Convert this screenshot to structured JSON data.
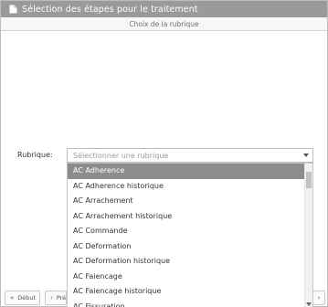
{
  "window": {
    "title": "Sélection des étapes pour le traitement",
    "icon": "document-icon"
  },
  "subheader": {
    "title": "Choix de la rubrique"
  },
  "rubrique": {
    "label": "Rubrique:",
    "placeholder": "Sélectionner une rubrique",
    "options": [
      "AC Adherence",
      "AC Adherence historique",
      "AC Arrachement",
      "AC Arrachement historique",
      "AC Commande",
      "AC Deformation",
      "AC Deformation historique",
      "AC Faiencage",
      "AC Faiencage historique",
      "AC Fissuration"
    ],
    "highlighted_index": 0
  },
  "footer": {
    "first_label": "Début",
    "prev_label": "Pré",
    "first_icon": "double-chevron-left-icon",
    "prev_icon": "chevron-left-icon",
    "next_icon": "chevron-right-icon"
  },
  "colors": {
    "titlebar": "#9a9a9a",
    "highlight": "#8c8c8c"
  }
}
